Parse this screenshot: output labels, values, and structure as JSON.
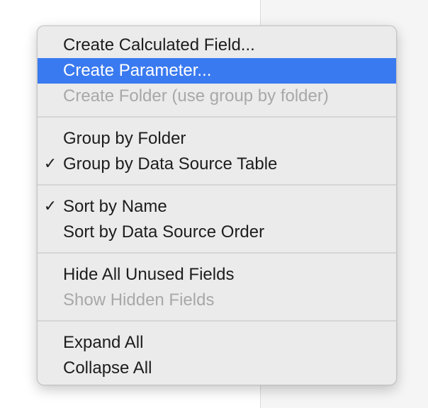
{
  "menu": {
    "groups": [
      {
        "items": [
          {
            "label": "Create Calculated Field...",
            "checked": false,
            "disabled": false,
            "highlighted": false
          },
          {
            "label": "Create Parameter...",
            "checked": false,
            "disabled": false,
            "highlighted": true
          },
          {
            "label": "Create Folder (use group by folder)",
            "checked": false,
            "disabled": true,
            "highlighted": false
          }
        ]
      },
      {
        "items": [
          {
            "label": "Group by Folder",
            "checked": false,
            "disabled": false,
            "highlighted": false
          },
          {
            "label": "Group by Data Source Table",
            "checked": true,
            "disabled": false,
            "highlighted": false
          }
        ]
      },
      {
        "items": [
          {
            "label": "Sort by Name",
            "checked": true,
            "disabled": false,
            "highlighted": false
          },
          {
            "label": "Sort by Data Source Order",
            "checked": false,
            "disabled": false,
            "highlighted": false
          }
        ]
      },
      {
        "items": [
          {
            "label": "Hide All Unused Fields",
            "checked": false,
            "disabled": false,
            "highlighted": false
          },
          {
            "label": "Show Hidden Fields",
            "checked": false,
            "disabled": true,
            "highlighted": false
          }
        ]
      },
      {
        "items": [
          {
            "label": "Expand All",
            "checked": false,
            "disabled": false,
            "highlighted": false
          },
          {
            "label": "Collapse All",
            "checked": false,
            "disabled": false,
            "highlighted": false
          }
        ]
      }
    ],
    "check_glyph": "✓",
    "highlight_color": "#3a7af0",
    "disabled_text_color": "#a8a8a8"
  }
}
